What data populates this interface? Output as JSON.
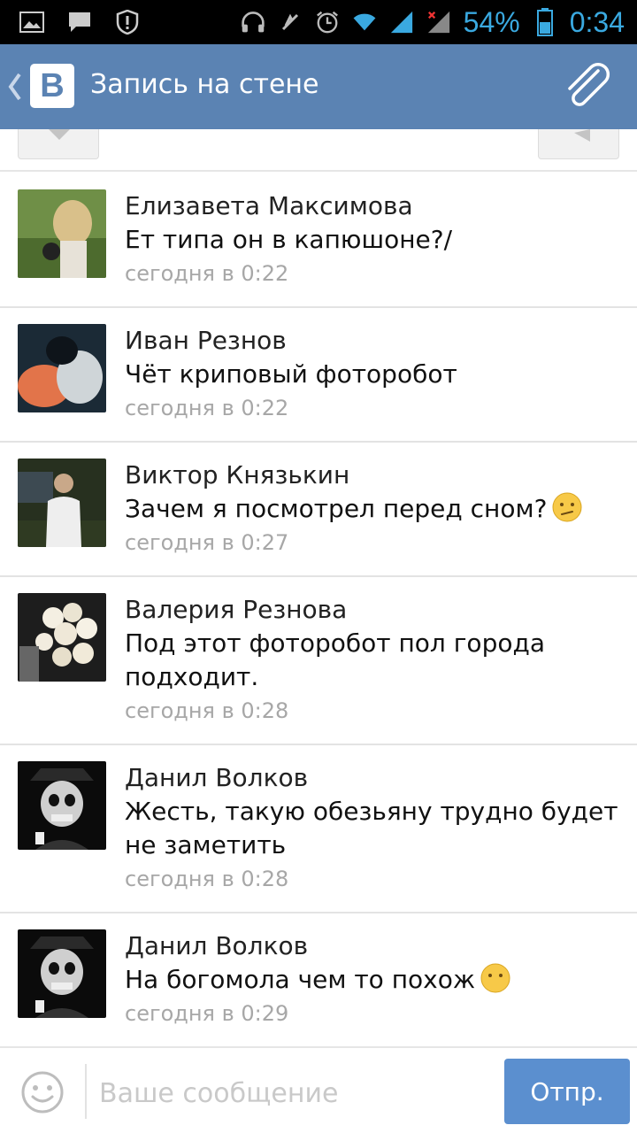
{
  "status_bar": {
    "battery_percent": "54%",
    "time": "0:34",
    "icons": [
      "image-icon",
      "message-icon",
      "alert-shield-icon",
      "headphones-icon",
      "mute-icon",
      "alarm-icon",
      "wifi-icon",
      "signal-icon",
      "signal-no-data-icon",
      "battery-icon"
    ]
  },
  "header": {
    "logo_letter": "B",
    "title": "Запись на стене",
    "icons": [
      "back-chevron-icon",
      "paperclip-icon"
    ]
  },
  "comments": [
    {
      "author": "Елизавета Максимова",
      "text": "Ет типа он в капюшоне?/",
      "time": "сегодня в 0:22",
      "emoji": ""
    },
    {
      "author": "Иван Резнов",
      "text": "Чёт криповый фоторобот",
      "time": "сегодня в 0:22",
      "emoji": ""
    },
    {
      "author": "Виктор Князькин",
      "text": "Зачем я посмотрел перед сном?",
      "time": "сегодня в 0:27",
      "emoji": "confused-face-icon"
    },
    {
      "author": "Валерия Резнова",
      "text": "Под этот фоторобот пол города подходит.",
      "time": "сегодня в 0:28",
      "emoji": ""
    },
    {
      "author": "Данил Волков",
      "text": "Жесть, такую обезьяну трудно будет не заметить",
      "time": "сегодня в 0:28",
      "emoji": ""
    },
    {
      "author": "Данил Волков",
      "text": "На богомола чем то похож",
      "time": "сегодня в 0:29",
      "emoji": "no-mouth-face-icon"
    }
  ],
  "composer": {
    "placeholder": "Ваше сообщение",
    "send_label": "Отпр."
  },
  "colors": {
    "header_bg": "#5b83b3",
    "send_bg": "#5b8fcf",
    "status_icon": "#3aa9e0",
    "time_text": "#a7a7a7"
  }
}
